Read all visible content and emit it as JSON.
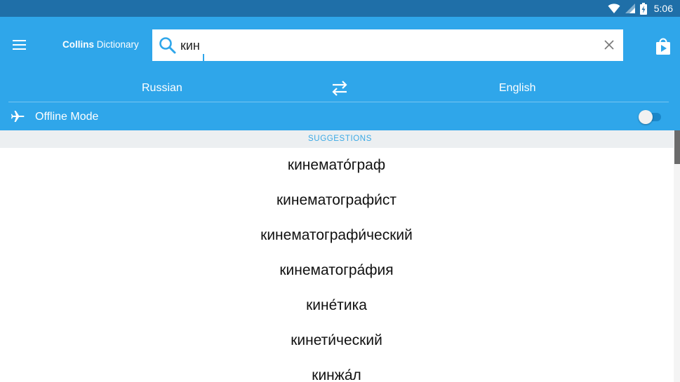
{
  "status_bar": {
    "time": "5:06",
    "icons": [
      "wifi-icon",
      "signal-icon",
      "battery-icon"
    ]
  },
  "header": {
    "brand_bold": "Collins",
    "brand_rest": "Dictionary",
    "menu_icon": "hamburger-menu-icon",
    "store_icon": "store-bag-icon"
  },
  "search": {
    "value": "кин",
    "placeholder": "",
    "clear_icon": "close-icon"
  },
  "languages": {
    "from": "Russian",
    "to": "English",
    "swap_icon": "swap-arrows-icon"
  },
  "offline": {
    "label": "Offline Mode",
    "enabled": false,
    "icon": "airplane-icon"
  },
  "suggestions": {
    "header": "SUGGESTIONS",
    "items": [
      "кинемато́граф",
      "кинематографи́ст",
      "кинематографи́ческий",
      "кинематогра́фия",
      "кине́тика",
      "кинети́ческий",
      "кинжа́л"
    ]
  },
  "colors": {
    "app_bar": "#2fa6ea",
    "status_bar": "#1f6fa8",
    "accent": "#3aa9e5"
  }
}
